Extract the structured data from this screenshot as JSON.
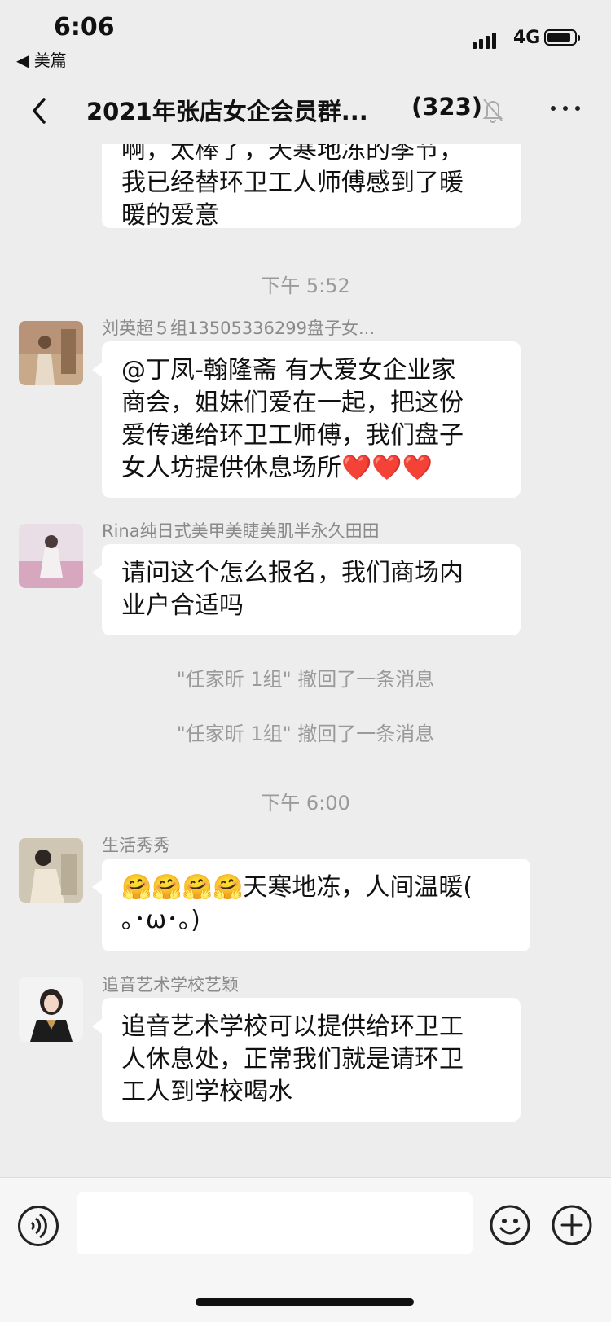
{
  "status_bar": {
    "time": "6:06",
    "back_app": "◀ 美篇",
    "network": "4G"
  },
  "header": {
    "title": "2021年张店女企会员群...",
    "count": "(323)"
  },
  "messages": [
    {
      "lines": [
        "啊，太棒了，天寒地冻的季节，",
        "我已经替环卫工人师傅感到了暖",
        "暖的爱意"
      ]
    },
    {
      "time": "下午 5:52"
    },
    {
      "sender": "刘英超５组13505336299盘子女...",
      "lines": [
        "@丁凤-翰隆斋 有大爱女企业家",
        "商会，姐妹们爱在一起，把这份",
        "爱传递给环卫工师傅，我们盘子",
        "女人坊提供休息场所❤️❤️❤️"
      ]
    },
    {
      "sender": "Rina纯日式美甲美睫美肌半永久田田",
      "lines": [
        "请问这个怎么报名，我们商场内",
        "业户合适吗"
      ]
    },
    {
      "system": "\"任家昕 1组\" 撤回了一条消息"
    },
    {
      "system": "\"任家昕 1组\" 撤回了一条消息"
    },
    {
      "time": "下午 6:00"
    },
    {
      "sender": "生活秀秀",
      "lines": [
        "🤗🤗🤗🤗天寒地冻，人间温暖(",
        "｡･ω･｡)"
      ]
    },
    {
      "sender": "追音艺术学校艺颖",
      "lines": [
        "追音艺术学校可以提供给环卫工",
        "人休息处，正常我们就是请环卫",
        "工人到学校喝水"
      ]
    }
  ],
  "icons": {
    "back": "chevron-left-icon",
    "mute": "bell-off-icon",
    "more": "more-dots-icon",
    "voice": "voice-icon",
    "emoji": "emoji-icon",
    "plus": "plus-icon"
  },
  "colors": {
    "background": "#ededed",
    "bubble": "#ffffff",
    "meta_text": "#9a9a9a"
  }
}
